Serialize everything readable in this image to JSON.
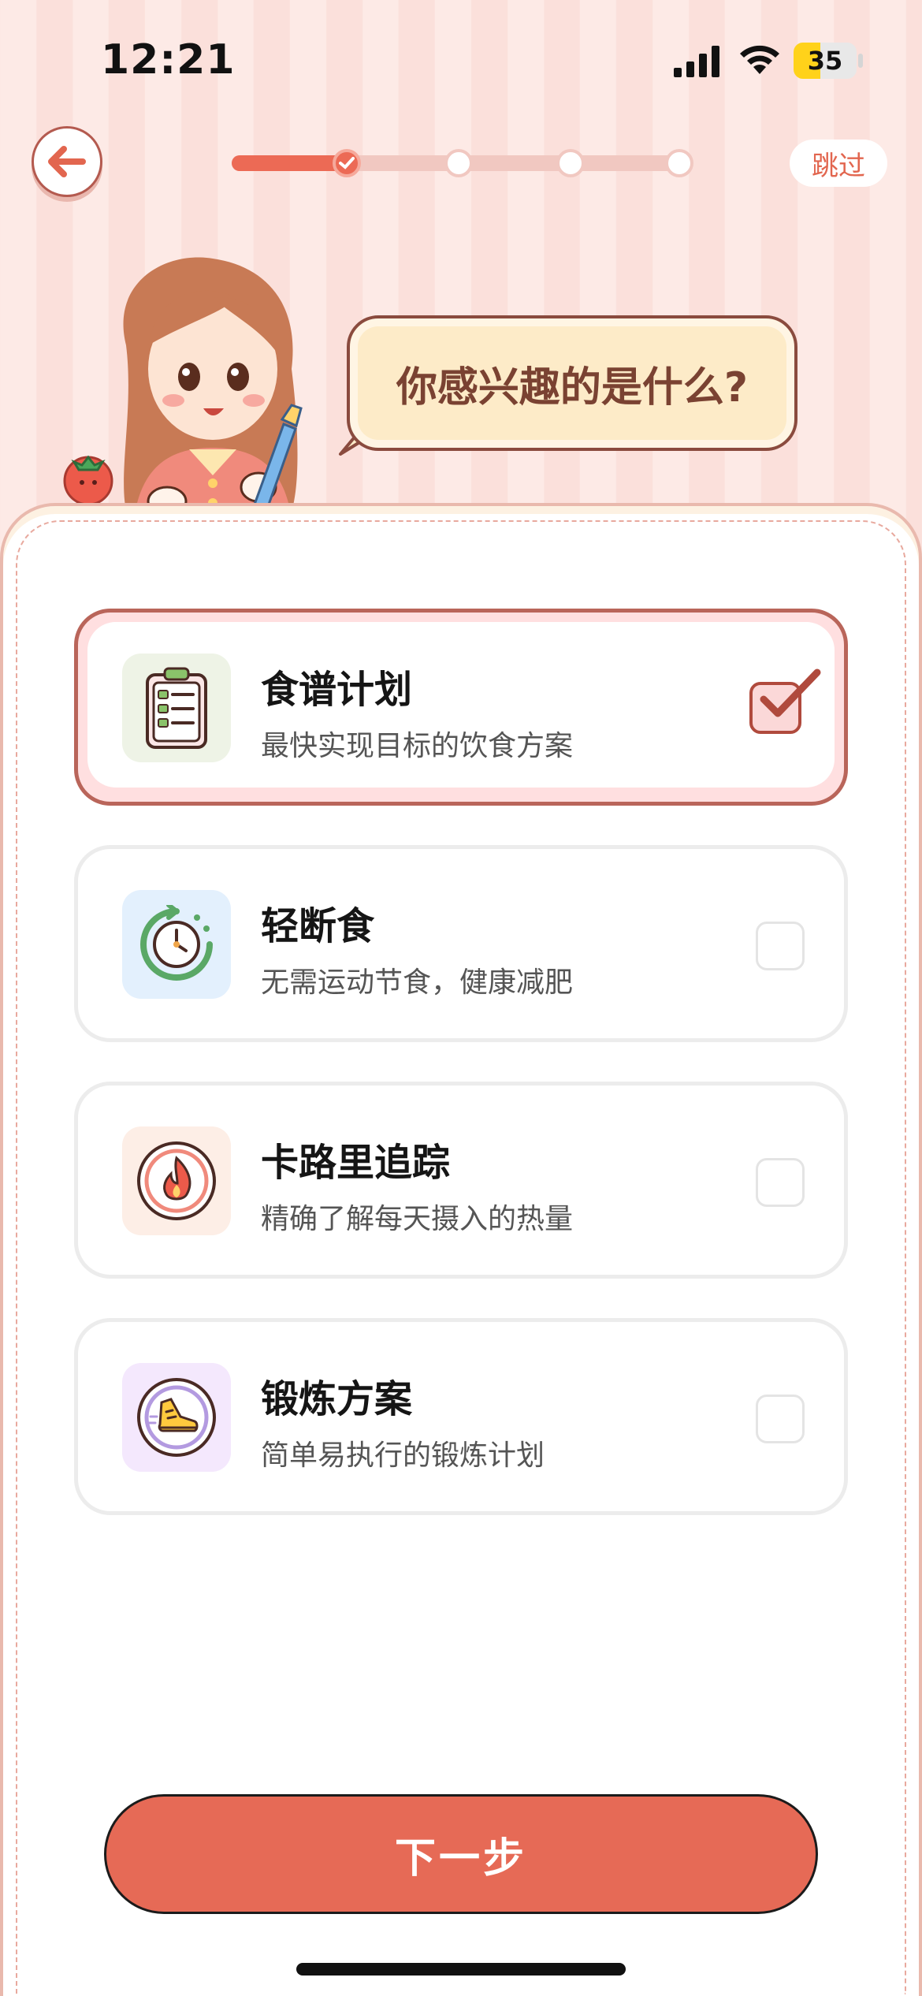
{
  "status_bar": {
    "time": "12:21",
    "battery": "35"
  },
  "header": {
    "skip_label": "跳过"
  },
  "hero": {
    "question": "你感兴趣的是什么?"
  },
  "options": [
    {
      "title": "食谱计划",
      "subtitle": "最快实现目标的饮食方案",
      "icon": "clipboard-icon",
      "selected": true
    },
    {
      "title": "轻断食",
      "subtitle": "无需运动节食，健康减肥",
      "icon": "stopwatch-icon",
      "selected": false
    },
    {
      "title": "卡路里追踪",
      "subtitle": "精确了解每天摄入的热量",
      "icon": "flame-icon",
      "selected": false
    },
    {
      "title": "锻炼方案",
      "subtitle": "简单易执行的锻炼计划",
      "icon": "sneaker-icon",
      "selected": false
    }
  ],
  "footer": {
    "next_label": "下一步"
  },
  "colors": {
    "accent": "#e66a56",
    "selected_border": "#b9655a",
    "bubble_bg": "#fdebc8"
  }
}
